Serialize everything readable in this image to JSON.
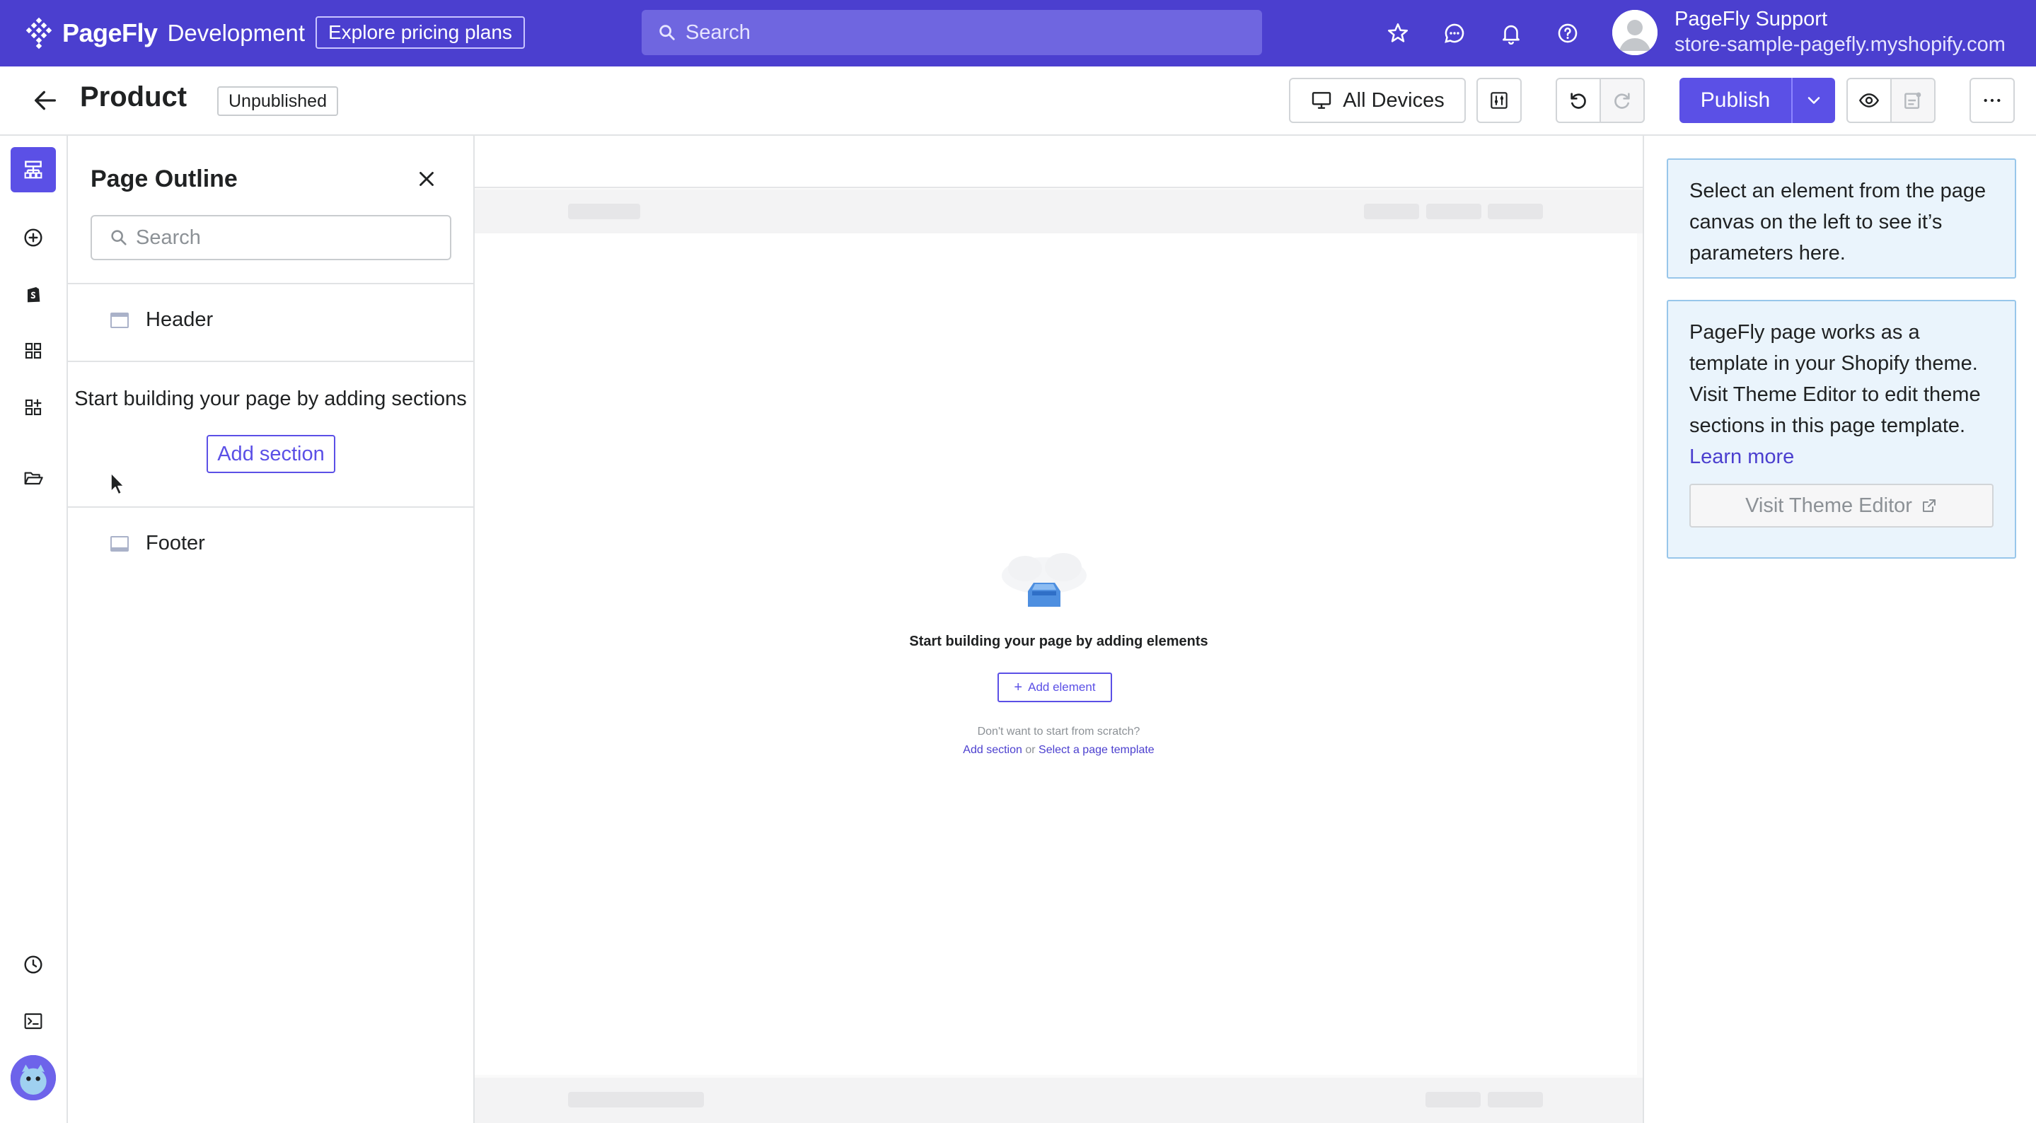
{
  "topbar": {
    "brand_name": "PageFly",
    "environment": "Development",
    "pricing_label": "Explore pricing plans",
    "search_placeholder": "Search",
    "user_name": "PageFly Support",
    "store": "store-sample-pagefly.myshopify.com",
    "icons": [
      "star-icon",
      "chat-icon",
      "bell-icon",
      "help-icon"
    ]
  },
  "header": {
    "title": "Product",
    "status": "Unpublished",
    "devices_label": "All Devices",
    "publish_label": "Publish"
  },
  "rail": {
    "icons": [
      "page-outline-icon",
      "add-icon",
      "shopify-icon",
      "grid-icon",
      "apps-icon",
      "folder-icon",
      "history-icon",
      "terminal-icon",
      "mascot-avatar-icon"
    ]
  },
  "outline": {
    "title": "Page Outline",
    "search_placeholder": "Search",
    "header_label": "Header",
    "empty_text": "Start building your page by adding sections",
    "add_section_label": "Add section",
    "footer_label": "Footer"
  },
  "canvas": {
    "empty_title": "Start building your page by adding elements",
    "add_element_label": "Add element",
    "scratch_text": "Don't want to start from scratch?",
    "add_section_link": "Add section",
    "or_text": "or",
    "template_link": "Select a page template"
  },
  "inspector": {
    "select_hint": "Select an element from the page canvas on the left to see it’s parameters here.",
    "theme_info": "PageFly page works as a template in your Shopify theme. Visit Theme Editor to edit theme sections in this page template.",
    "learn_more": "Learn more",
    "visit_theme_editor": "Visit Theme Editor"
  },
  "colors": {
    "brand": "#4b3fcf",
    "accent": "#5b50e6",
    "info_bg": "#eaf4fc",
    "info_border": "#98c6ea"
  }
}
